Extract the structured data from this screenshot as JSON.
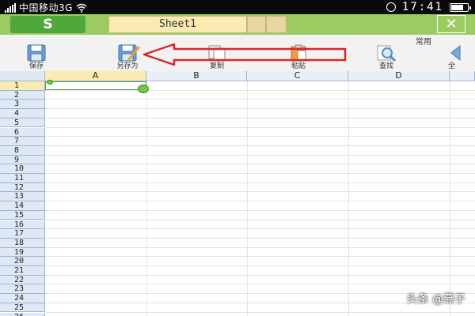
{
  "status": {
    "carrier": "中国移动3G",
    "time": "17:41"
  },
  "tabbar": {
    "app_button": "S",
    "sheet_tab": "Sheet1",
    "close_label": "✕"
  },
  "toolbar": {
    "group_label": "常用",
    "tools": [
      {
        "label": "保存",
        "icon": "save-icon"
      },
      {
        "label": "另存为",
        "icon": "save-as-icon"
      },
      {
        "label": "复制",
        "icon": "copy-icon"
      },
      {
        "label": "粘贴",
        "icon": "paste-icon"
      },
      {
        "label": "查找",
        "icon": "find-icon"
      },
      {
        "label": "全",
        "icon": "select-all-icon"
      }
    ]
  },
  "sheet": {
    "columns": [
      "A",
      "B",
      "C",
      "D"
    ],
    "rows": [
      "1",
      "2",
      "3",
      "4",
      "5",
      "6",
      "7",
      "8",
      "9",
      "10",
      "11",
      "12",
      "13",
      "14",
      "15",
      "16",
      "17",
      "18",
      "19",
      "20",
      "21",
      "22",
      "23",
      "24",
      "25",
      "26"
    ],
    "selected_column": "A",
    "selected_row": "1"
  },
  "watermark": "头条 @燕子",
  "colors": {
    "tab_green": "#9ccb64",
    "app_green": "#4fa83a",
    "active_tab": "#fbeab2",
    "arrow_red": "#d9262b",
    "header_blue": "#dfe8f5"
  }
}
